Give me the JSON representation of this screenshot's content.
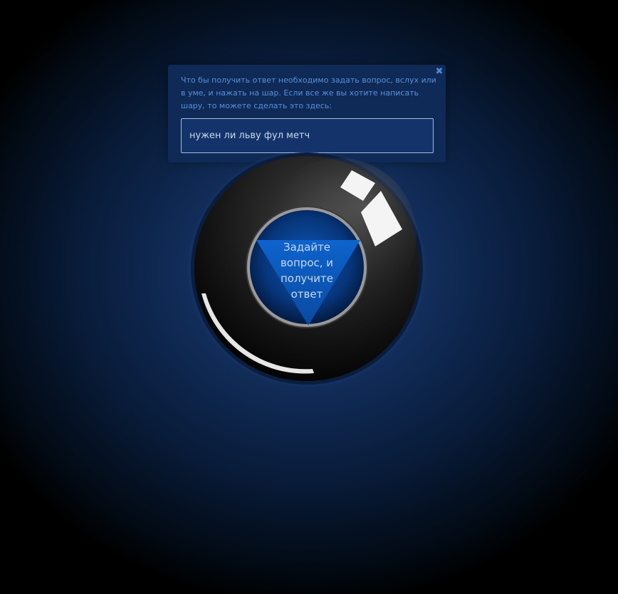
{
  "popup": {
    "instruction": "Что бы получить ответ необходимо задать вопрос, вслух или в уме, и нажать на шар. Если все же вы хотите написать шару, то можете сделать это здесь:",
    "close_icon": "close-icon",
    "close_glyph": "✖",
    "question_value": "нужен ли льву фул метч"
  },
  "ball": {
    "label": "Задайте вопрос, и получите ответ"
  },
  "colors": {
    "background_center": "#1a3f7a",
    "popup_bg": "#0f2a56",
    "popup_text": "#5a8fdc",
    "input_bg": "#14336a",
    "window_blue": "#0a4aa0"
  }
}
